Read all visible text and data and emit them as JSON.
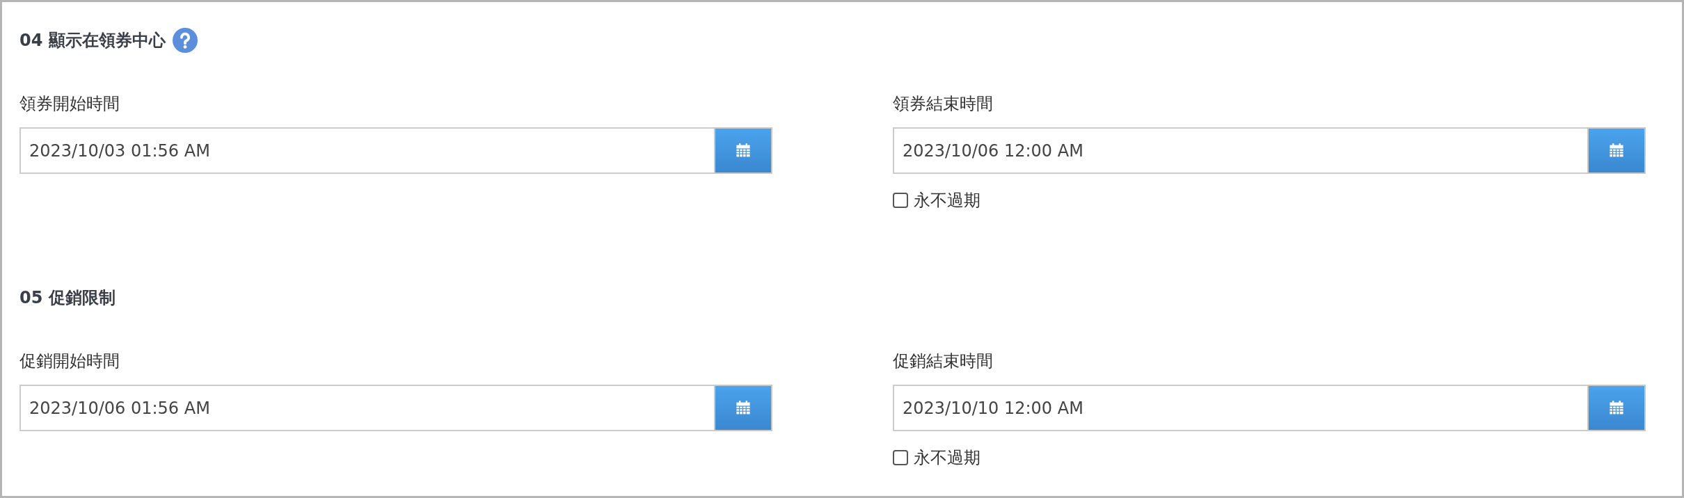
{
  "sections": [
    {
      "title": "04 顯示在領券中心",
      "help": true,
      "fields": [
        {
          "label": "領券開始時間",
          "value": "2023/10/03 01:56 AM"
        },
        {
          "label": "領券結束時間",
          "value": "2023/10/06 12:00 AM",
          "option": {
            "label": "永不過期",
            "checked": false
          }
        }
      ]
    },
    {
      "title": "05 促銷限制",
      "help": false,
      "fields": [
        {
          "label": "促銷開始時間",
          "value": "2023/10/06 01:56 AM"
        },
        {
          "label": "促銷結束時間",
          "value": "2023/10/10 12:00 AM",
          "option": {
            "label": "永不過期",
            "checked": false
          }
        }
      ]
    }
  ]
}
